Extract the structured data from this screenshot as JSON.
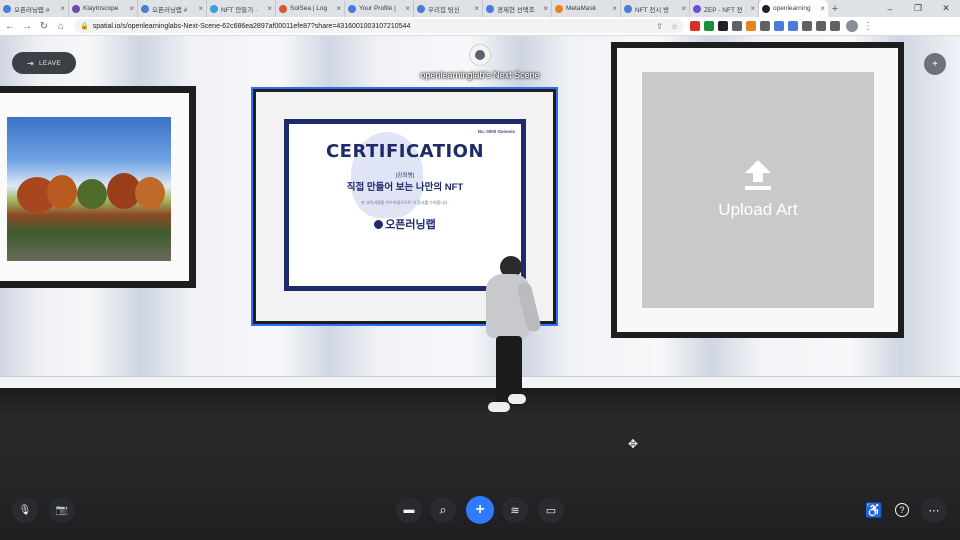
{
  "browser": {
    "tabs": [
      {
        "label": "오픈러닝랩 #",
        "color": "#4a7bd8"
      },
      {
        "label": "Klaytnscope",
        "color": "#6b4ba8"
      },
      {
        "label": "오픈러닝랩 #",
        "color": "#4a7bd8"
      },
      {
        "label": "NFT 만들기 ·",
        "color": "#3aa0d6"
      },
      {
        "label": "SolSea | Log",
        "color": "#d35a2b"
      },
      {
        "label": "Your Profile |",
        "color": "#4a7bd8"
      },
      {
        "label": "우리집 팅신",
        "color": "#4a7bd8"
      },
      {
        "label": "경제현 선택조",
        "color": "#4a7bd8"
      },
      {
        "label": "MetaMask",
        "color": "#e8831d"
      },
      {
        "label": "NFT 전시 방",
        "color": "#4a7bd8"
      },
      {
        "label": "ZEP - NFT 전",
        "color": "#6c4fd6"
      },
      {
        "label": "openlearning",
        "color": "#202124"
      }
    ],
    "new_tab": "+",
    "url": "spatial.io/s/openlearninglabs-Next-Scene-62c686ea2897af00011efe87?share=4316001003107210544",
    "window": {
      "minimize": "–",
      "restore": "❐",
      "close": "✕"
    }
  },
  "scene": {
    "leave_label": "LEAVE",
    "host_name": "openlearninglab's Next Scene",
    "certificate": {
      "serial": "No. 0000 Genesis",
      "title": "CERTIFICATION",
      "tag": "[강좌명]",
      "subtitle": "직접 만들어 보는 나만의 NFT",
      "description": "본 교육과정을 이수하였으므로 이 증서를 수여합니다.",
      "org": "오픈러닝랩"
    },
    "upload_label": "Upload Art"
  },
  "bottom_bar": {
    "left": [
      {
        "name": "mic-off-icon",
        "glyph": "🎙"
      },
      {
        "name": "camera-off-icon",
        "glyph": "📷"
      }
    ],
    "center": [
      {
        "name": "content-icon",
        "glyph": "▬"
      },
      {
        "name": "search-icon",
        "glyph": "⌕"
      },
      {
        "name": "add-icon",
        "glyph": "+"
      },
      {
        "name": "emote-icon",
        "glyph": "≋"
      },
      {
        "name": "screen-share-icon",
        "glyph": "▭"
      }
    ],
    "right": [
      {
        "name": "accessibility-icon",
        "glyph": "♿"
      },
      {
        "name": "help-icon",
        "glyph": "?"
      },
      {
        "name": "more-icon",
        "glyph": "⋯"
      }
    ]
  }
}
